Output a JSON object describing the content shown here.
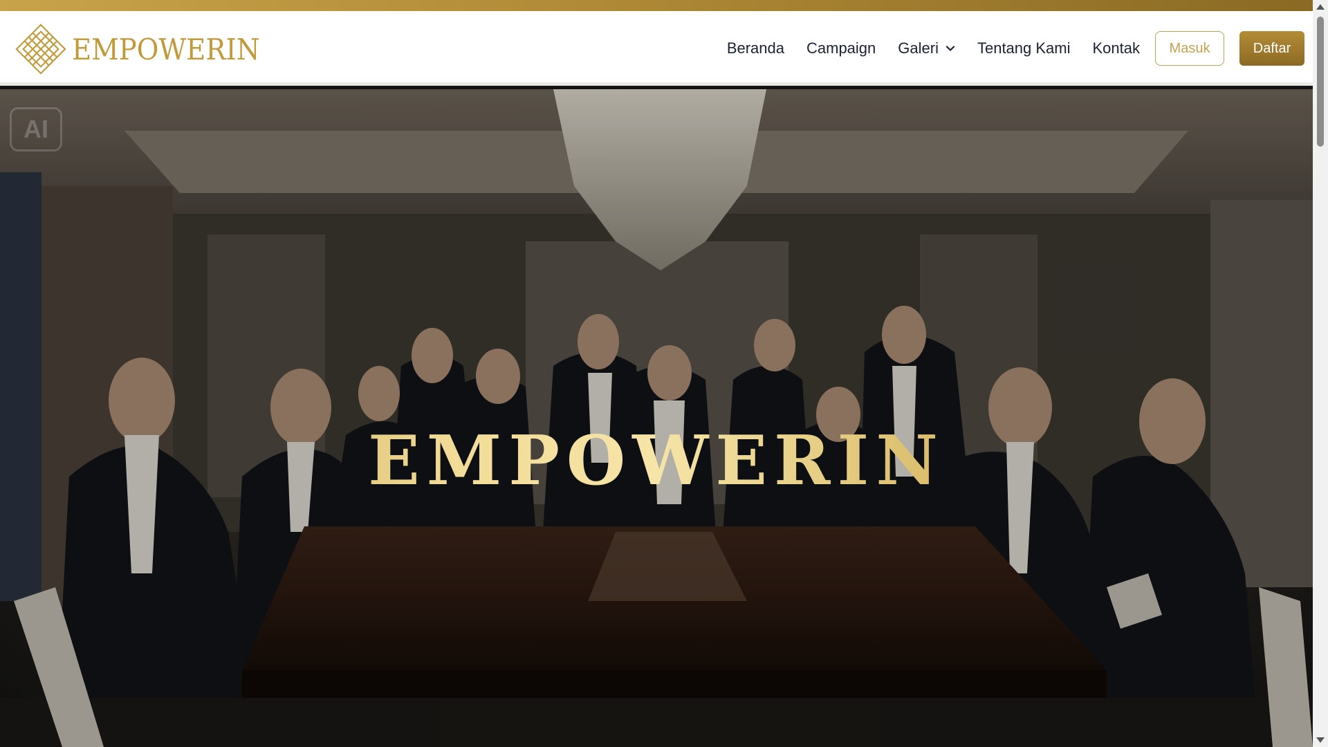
{
  "brand": {
    "name": "EMPOWERIN",
    "logo_icon": "diamond-lattice-icon",
    "color": "#c29a3a"
  },
  "nav": {
    "items": [
      {
        "label": "Beranda"
      },
      {
        "label": "Campaign"
      },
      {
        "label": "Galeri",
        "has_dropdown": true
      },
      {
        "label": "Tentang Kami"
      },
      {
        "label": "Kontak"
      }
    ],
    "login_label": "Masuk",
    "register_label": "Daftar"
  },
  "hero": {
    "title": "EMPOWERIN",
    "badge": "AI"
  },
  "colors": {
    "accent_gold": "#c5a14f",
    "nav_text": "#1b2233",
    "top_strip": "#b08a36"
  }
}
